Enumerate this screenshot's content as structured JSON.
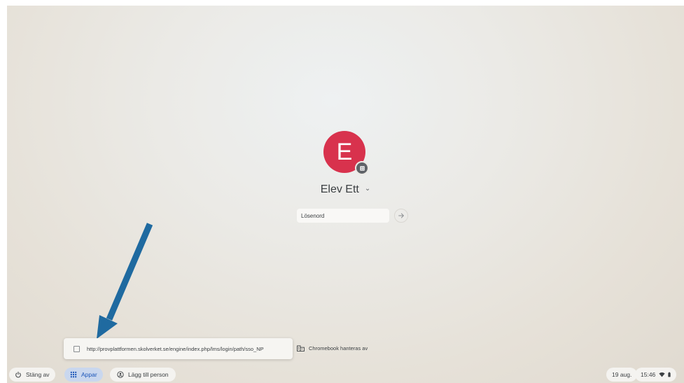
{
  "user": {
    "avatar_letter": "E",
    "name": "Elev Ett",
    "avatar_color": "#d8324d"
  },
  "password": {
    "placeholder": "Lösenord"
  },
  "tooltip": {
    "url": "http://provplattformen.skolverket.se/engine/index.php/lms/login/path/sso_NP"
  },
  "managed": {
    "label": "Chromebook hanteras av"
  },
  "shelf": {
    "shutdown_label": "Stäng av",
    "apps_label": "Appar",
    "add_person_label": "Lägg till person",
    "date": "19 aug.",
    "time": "15:46"
  },
  "icons": {
    "shutdown": "power-icon",
    "apps": "grid-icon",
    "add_person": "add-person-icon",
    "managed": "building-icon",
    "wifi": "wifi-icon",
    "battery": "battery-icon",
    "submit": "arrow-right-icon",
    "badge": "enterprise-badge-icon",
    "pointer": "blue-arrow-annotation"
  },
  "colors": {
    "accent": "#1a55b8",
    "apps_highlight": "#c9d7ee",
    "annotation_arrow": "#1f6aa0"
  }
}
